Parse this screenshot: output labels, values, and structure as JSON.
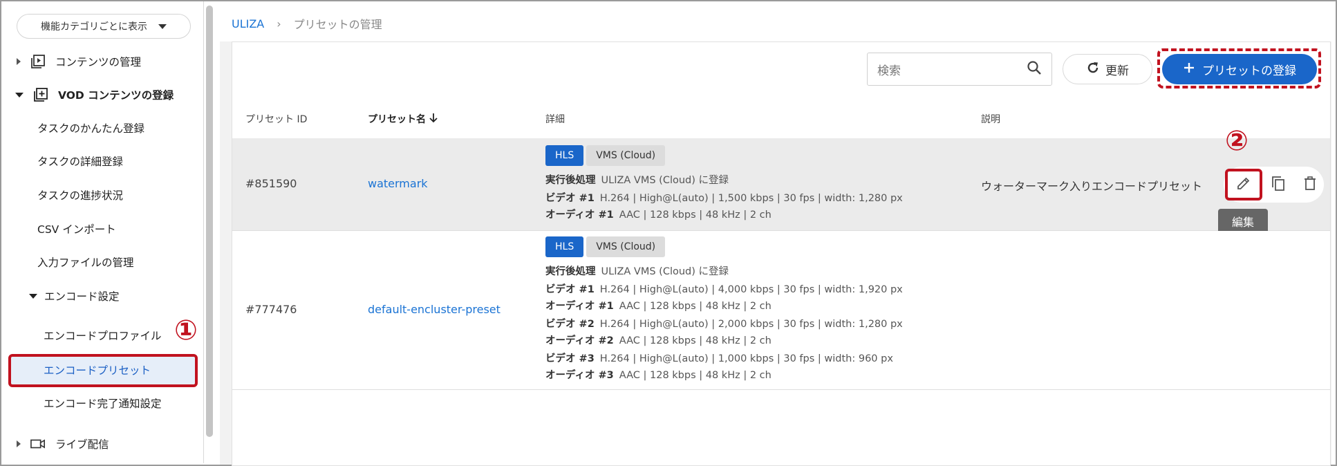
{
  "sidebar": {
    "view_select": "機能カテゴリごとに表示",
    "items": [
      {
        "label": "コンテンツの管理"
      },
      {
        "label": "VOD コンテンツの登録"
      },
      {
        "label": "タスクのかんたん登録"
      },
      {
        "label": "タスクの詳細登録"
      },
      {
        "label": "タスクの進捗状況"
      },
      {
        "label": "CSV インポート"
      },
      {
        "label": "入力ファイルの管理"
      },
      {
        "label": "エンコード設定"
      },
      {
        "label": "エンコードプロファイル"
      },
      {
        "label": "エンコードプリセット"
      },
      {
        "label": "エンコード完了通知設定"
      },
      {
        "label": "ライブ配信"
      }
    ]
  },
  "annotations": {
    "step1": "①",
    "step2": "②"
  },
  "breadcrumb": {
    "root": "ULIZA",
    "sep": "›",
    "current": "プリセットの管理"
  },
  "toolbar": {
    "search_placeholder": "検索",
    "refresh_label": "更新",
    "register_label": "プリセットの登録"
  },
  "table": {
    "headers": {
      "id": "プリセット ID",
      "name": "プリセット名",
      "detail": "詳細",
      "description": "説明"
    },
    "rows": [
      {
        "id": "#851590",
        "name": "watermark",
        "tags": [
          "HLS",
          "VMS (Cloud)"
        ],
        "post_label": "実行後処理",
        "post_value": "ULIZA VMS (Cloud) に登録",
        "lines": [
          {
            "label": "ビデオ #1",
            "value": "H.264 | High@L(auto) | 1,500 kbps | 30 fps | width: 1,280 px"
          },
          {
            "label": "オーディオ #1",
            "value": "AAC | 128 kbps | 48 kHz | 2 ch"
          }
        ],
        "description": "ウォーターマーク入りエンコードプリセット"
      },
      {
        "id": "#777476",
        "name": "default-encluster-preset",
        "tags": [
          "HLS",
          "VMS (Cloud)"
        ],
        "post_label": "実行後処理",
        "post_value": "ULIZA VMS (Cloud) に登録",
        "lines": [
          {
            "label": "ビデオ #1",
            "value": "H.264 | High@L(auto) | 4,000 kbps | 30 fps | width: 1,920 px"
          },
          {
            "label": "オーディオ #1",
            "value": "AAC | 128 kbps | 48 kHz | 2 ch"
          },
          {
            "label": "ビデオ #2",
            "value": "H.264 | High@L(auto) | 2,000 kbps | 30 fps | width: 1,280 px"
          },
          {
            "label": "オーディオ #2",
            "value": "AAC | 128 kbps | 48 kHz | 2 ch"
          },
          {
            "label": "ビデオ #3",
            "value": "H.264 | High@L(auto) | 1,000 kbps | 30 fps | width: 960 px"
          },
          {
            "label": "オーディオ #3",
            "value": "AAC | 128 kbps | 48 kHz | 2 ch"
          }
        ],
        "description": ""
      }
    ]
  },
  "tooltip": "編集",
  "colors": {
    "accent": "#1a66c9",
    "highlight": "#c1121f",
    "link": "#1a73d4"
  }
}
